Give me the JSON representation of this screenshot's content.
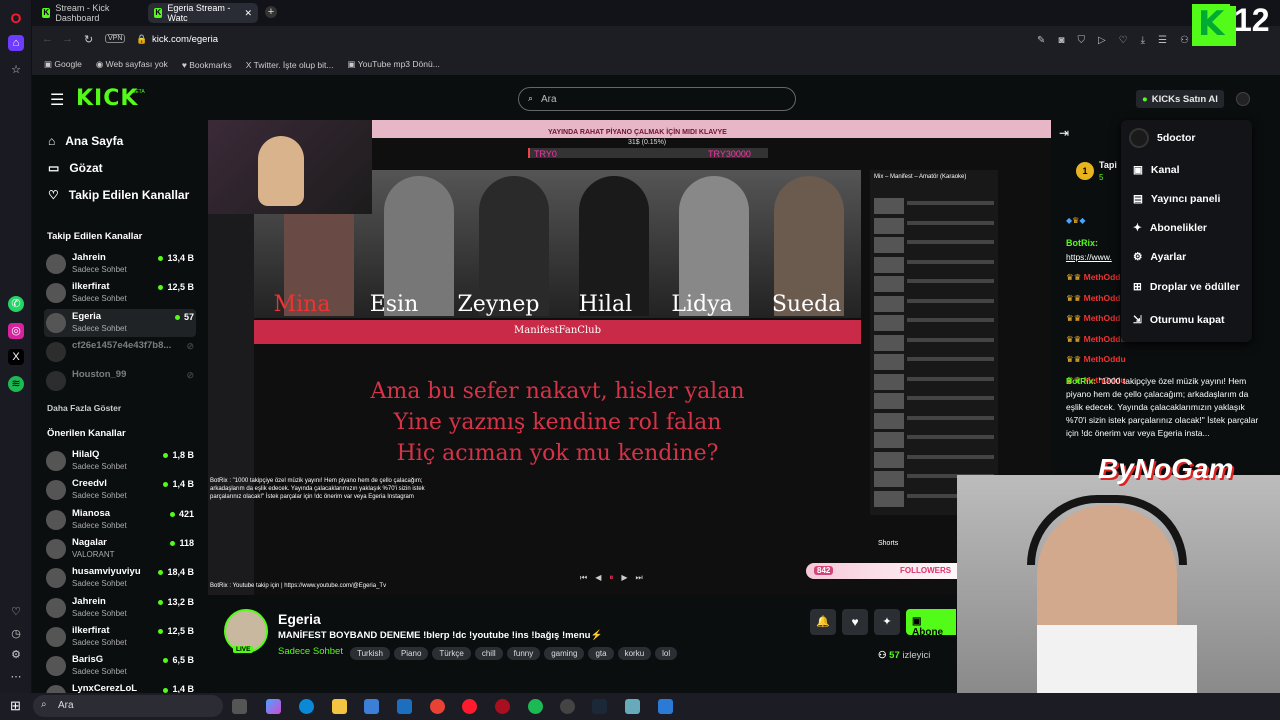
{
  "tabs": [
    {
      "label": "Stream - Kick Dashboard"
    },
    {
      "label": "Egeria Stream - Watc"
    }
  ],
  "address": {
    "url": "kick.com/egeria",
    "vpn": "VPN"
  },
  "bookmarks": [
    "Google",
    "Web sayfası yok",
    "Bookmarks",
    "Twitter. İşte olup bit...",
    "YouTube mp3 Dönü..."
  ],
  "kick": {
    "logo": "KICK",
    "beta": "BETA",
    "search_placeholder": "Ara",
    "buy_kicks": "KICKs Satın Al"
  },
  "nav": {
    "home": "Ana Sayfa",
    "browse": "Gözat",
    "following": "Takip Edilen Kanallar"
  },
  "followed_header": "Takip Edilen Kanallar",
  "followed": [
    {
      "name": "Jahrein",
      "sub": "Sadece Sohbet",
      "viewers": "13,4 B"
    },
    {
      "name": "ilkerfirat",
      "sub": "Sadece Sohbet",
      "viewers": "12,5 B"
    },
    {
      "name": "Egeria",
      "sub": "Sadece Sohbet",
      "viewers": "57"
    },
    {
      "name": "cf26e1457e4e43f7b8...",
      "sub": "",
      "viewers": ""
    },
    {
      "name": "Houston_99",
      "sub": "",
      "viewers": ""
    }
  ],
  "show_more": "Daha Fazla Göster",
  "recommended_header": "Önerilen Kanallar",
  "recommended": [
    {
      "name": "HilalQ",
      "sub": "Sadece Sohbet",
      "viewers": "1,8 B"
    },
    {
      "name": "Creedvl",
      "sub": "Sadece Sohbet",
      "viewers": "1,4 B"
    },
    {
      "name": "Mianosa",
      "sub": "Sadece Sohbet",
      "viewers": "421"
    },
    {
      "name": "Nagalar",
      "sub": "VALORANT",
      "viewers": "118"
    },
    {
      "name": "husamviyuviyu",
      "sub": "Sadece Sohbet",
      "viewers": "18,4 B"
    },
    {
      "name": "Jahrein",
      "sub": "Sadece Sohbet",
      "viewers": "13,2 B"
    },
    {
      "name": "ilkerfirat",
      "sub": "Sadece Sohbet",
      "viewers": "12,5 B"
    },
    {
      "name": "BarisG",
      "sub": "Sadece Sohbet",
      "viewers": "6,5 B"
    },
    {
      "name": "LynxCerezLoL",
      "sub": "",
      "viewers": "1,4 B"
    }
  ],
  "video": {
    "banner_top": "YAYINDA RAHAT PİYANO ÇALMAK İÇİN MIDI KLAVYE",
    "banner_progress": "31$ (0.15%)",
    "try_left": "TRY0",
    "try_right": "TRY30000",
    "members": [
      "Mina",
      "Esin",
      "Zeynep",
      "Hilal",
      "Lidya",
      "Sueda"
    ],
    "club": "ManifestFanClub",
    "lyrics": [
      "Ama bu sefer nakavt, hisler yalan",
      "Yine yazmış kendine rol falan",
      "Hiç acıman yok mu kendine?"
    ],
    "followers_count": "842",
    "followers_label": "FOLLOWERS",
    "bynogam": "ByNoGam",
    "mix_title": "Mix – Manifest – Amatör (Karaoke)",
    "overlay_chat": "BotRix : \"1000 takipçiye özel müzik yayını! Hem piyano hem de çello çalacağım; arkadaşlarım da eşlik edecek. Yayında çalacaklarımızın yaklaşık %70'i sizin istek parçalarınız olacak!\" İstek parçalar için !dc önerim var veya Egeria Instagram",
    "yt_link": "BotRix : Youtube takip için | https://www.youtube.com/@Egeria_Tv",
    "shorts": "Shorts",
    "kick_badge": "12"
  },
  "streamer": {
    "name": "Egeria",
    "title": "MANİFEST BOYBAND DENEME !blerp !dc !youtube !ins !bağış !menu⚡",
    "category": "Sadece Sohbet",
    "tags": [
      "Turkish",
      "Piano",
      "Türkçe",
      "chill",
      "funny",
      "gaming",
      "gta",
      "korku",
      "lol"
    ],
    "viewers": "57",
    "viewers_label": "izleyici",
    "live": "LIVE",
    "subscribe": "Abone"
  },
  "menu": {
    "user": "5doctor",
    "items": [
      "Kanal",
      "Yayıncı paneli",
      "Abonelikler",
      "Ayarlar",
      "Droplar ve ödüller",
      "Oturumu kapat"
    ]
  },
  "chat": {
    "pinned_user": "Tapi",
    "pinned_count": "5",
    "bot_user": "BotRix:",
    "link": "https://www.",
    "msg": "\"1000 takipçiye özel müzik yayını! Hem piyano hem de çello çalacağım; arkadaşlarım da eşlik edecek. Yayında çalacaklarımızın yaklaşık %70'i sizin istek parçalarınız olacak!\" İstek parçalar için !dc önerim var veya Egeria insta...",
    "meth": "MethOddu"
  },
  "taskbar": {
    "search": "Ara"
  },
  "colors": {
    "kick_green": "#53fc18",
    "bg": "#0b0e0f",
    "banner_pink": "#c92a48"
  }
}
